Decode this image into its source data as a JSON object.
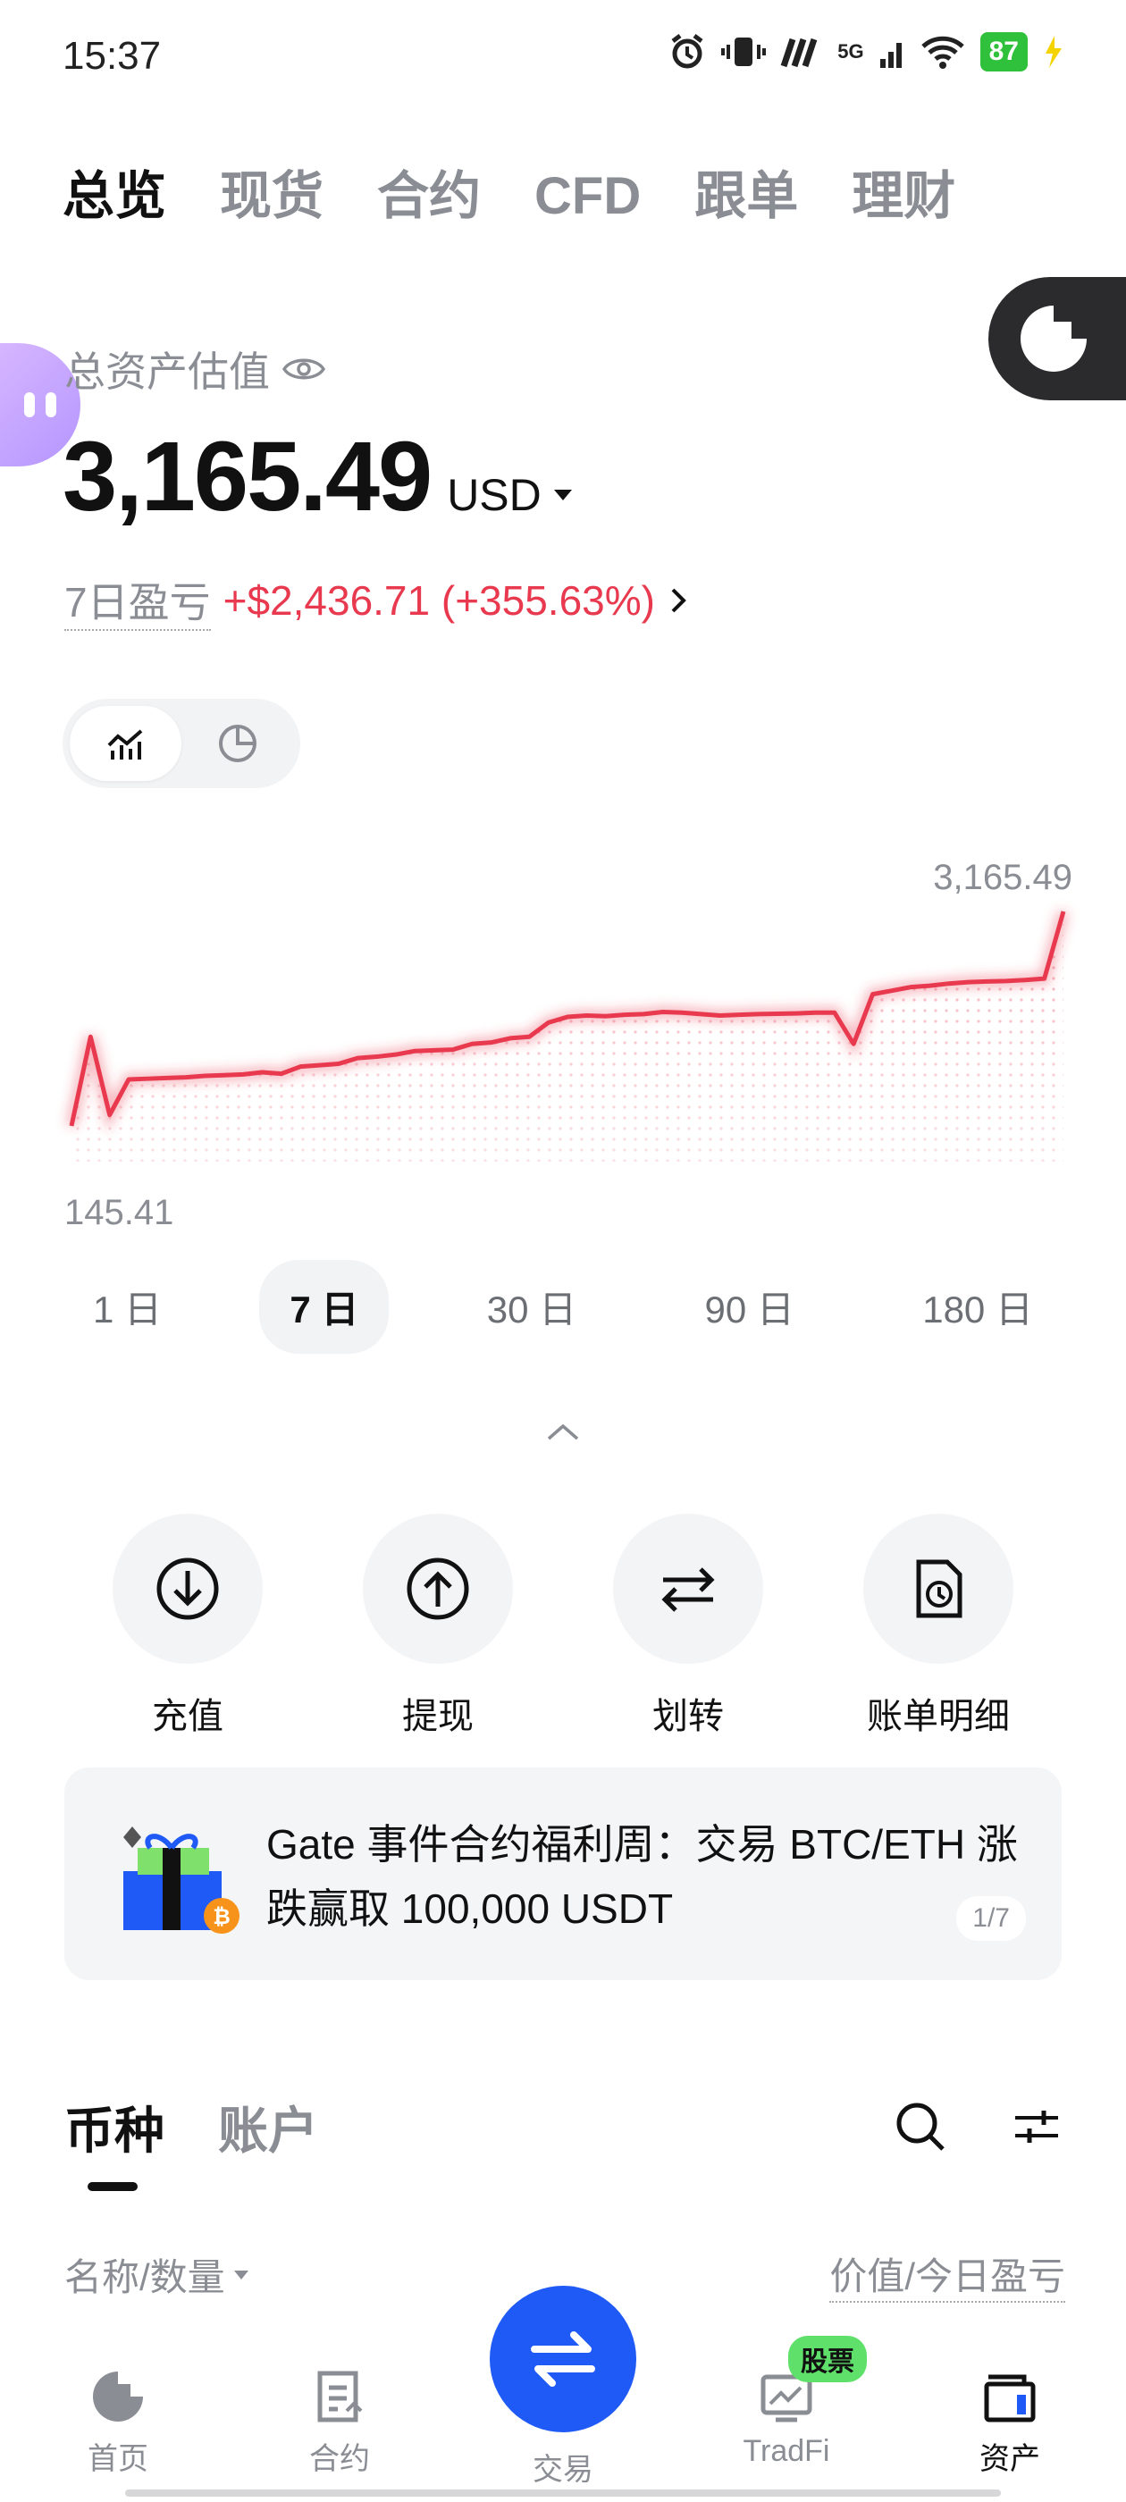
{
  "status": {
    "time": "15:37",
    "battery": "87",
    "network": "5G"
  },
  "top_tabs": [
    {
      "label": "总览",
      "active": true
    },
    {
      "label": "现货",
      "active": false
    },
    {
      "label": "合约",
      "active": false
    },
    {
      "label": "CFD",
      "active": false
    },
    {
      "label": "跟单",
      "active": false
    },
    {
      "label": "理财",
      "active": false
    }
  ],
  "overview": {
    "asset_label": "总资产估值",
    "asset_value": "3,165.49",
    "currency": "USD",
    "pnl_label": "7日盈亏",
    "pnl_value": "+$2,436.71 (+355.63%)"
  },
  "chart_data": {
    "type": "area",
    "max_label": "3,165.49",
    "min_label": "145.41",
    "values": [
      145.41,
      1400,
      300,
      800,
      810,
      820,
      830,
      850,
      860,
      870,
      900,
      880,
      980,
      1000,
      1020,
      1100,
      1120,
      1150,
      1200,
      1210,
      1220,
      1300,
      1320,
      1380,
      1400,
      1600,
      1680,
      1700,
      1690,
      1710,
      1720,
      1750,
      1740,
      1720,
      1700,
      1710,
      1720,
      1725,
      1730,
      1740,
      1740,
      1300,
      2000,
      2050,
      2100,
      2120,
      2150,
      2170,
      2180,
      2185,
      2200,
      2220,
      3165.49
    ],
    "line_color": "#e8394f"
  },
  "time_ranges": [
    {
      "label": "1 日",
      "active": false
    },
    {
      "label": "7 日",
      "active": true
    },
    {
      "label": "30 日",
      "active": false
    },
    {
      "label": "90 日",
      "active": false
    },
    {
      "label": "180 日",
      "active": false
    }
  ],
  "actions": [
    {
      "label": "充值",
      "icon": "deposit-icon"
    },
    {
      "label": "提现",
      "icon": "withdraw-icon"
    },
    {
      "label": "划转",
      "icon": "transfer-icon"
    },
    {
      "label": "账单明细",
      "icon": "bill-icon"
    }
  ],
  "banner": {
    "text": "Gate 事件合约福利周：交易 BTC/ETH 涨跌赢取 100,000 USDT",
    "pager": "1/7"
  },
  "asset_tabs": [
    {
      "label": "币种",
      "active": true
    },
    {
      "label": "账户",
      "active": false
    }
  ],
  "list_header": {
    "left": "名称/数量",
    "right": "价值/今日盈亏"
  },
  "bottom_nav": {
    "home": "首页",
    "futures": "合约",
    "trade": "交易",
    "tradfi": "TradFi",
    "assets": "资产",
    "stock_badge": "股票"
  },
  "colors": {
    "accent": "#1f5af6",
    "loss_gain_red": "#e8394f",
    "badge_green": "#5fe06a"
  }
}
